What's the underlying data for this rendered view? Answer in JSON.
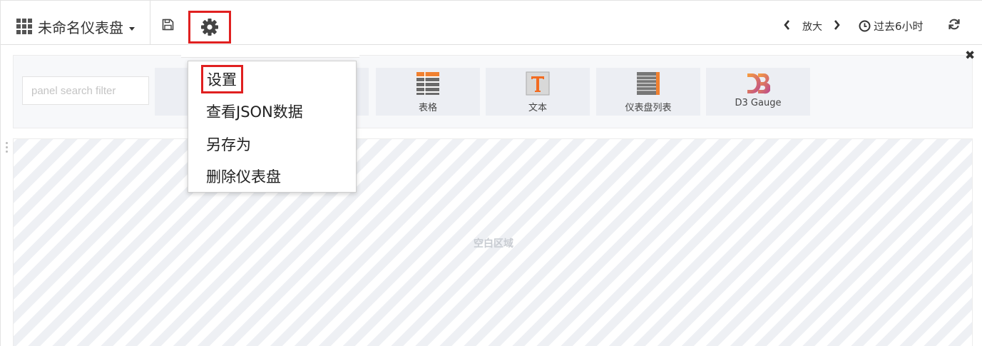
{
  "navbar": {
    "dashboard_title": "未命名仪表盘",
    "zoom_label": "放大",
    "time_range": "过去6小时"
  },
  "icons": {
    "grid": "dashboard-grid-icon",
    "save": "save-icon",
    "settings": "gear-icon",
    "prev": "chevron-left-icon",
    "next": "chevron-right-icon",
    "clock": "clock-icon",
    "refresh": "refresh-icon",
    "close": "close-icon"
  },
  "add_panel": {
    "search_placeholder": "panel search filter",
    "close_symbol": "✖",
    "panels": [
      {
        "label": "表格",
        "icon": "table-icon"
      },
      {
        "label": "文本",
        "icon": "text-icon"
      },
      {
        "label": "仪表盘列表",
        "icon": "dashboard-list-icon"
      },
      {
        "label": "D3 Gauge",
        "icon": "d3-gauge-icon"
      }
    ]
  },
  "empty_area": {
    "label": "空白区域"
  },
  "settings_menu": {
    "items": [
      "设置",
      "查看JSON数据",
      "另存为",
      "删除仪表盘"
    ]
  },
  "colors": {
    "highlight_box": "#e02020",
    "table_icon_orange": "#f08030",
    "text_icon_bg": "#d8d8d8",
    "d3_orange": "#f26b21"
  }
}
